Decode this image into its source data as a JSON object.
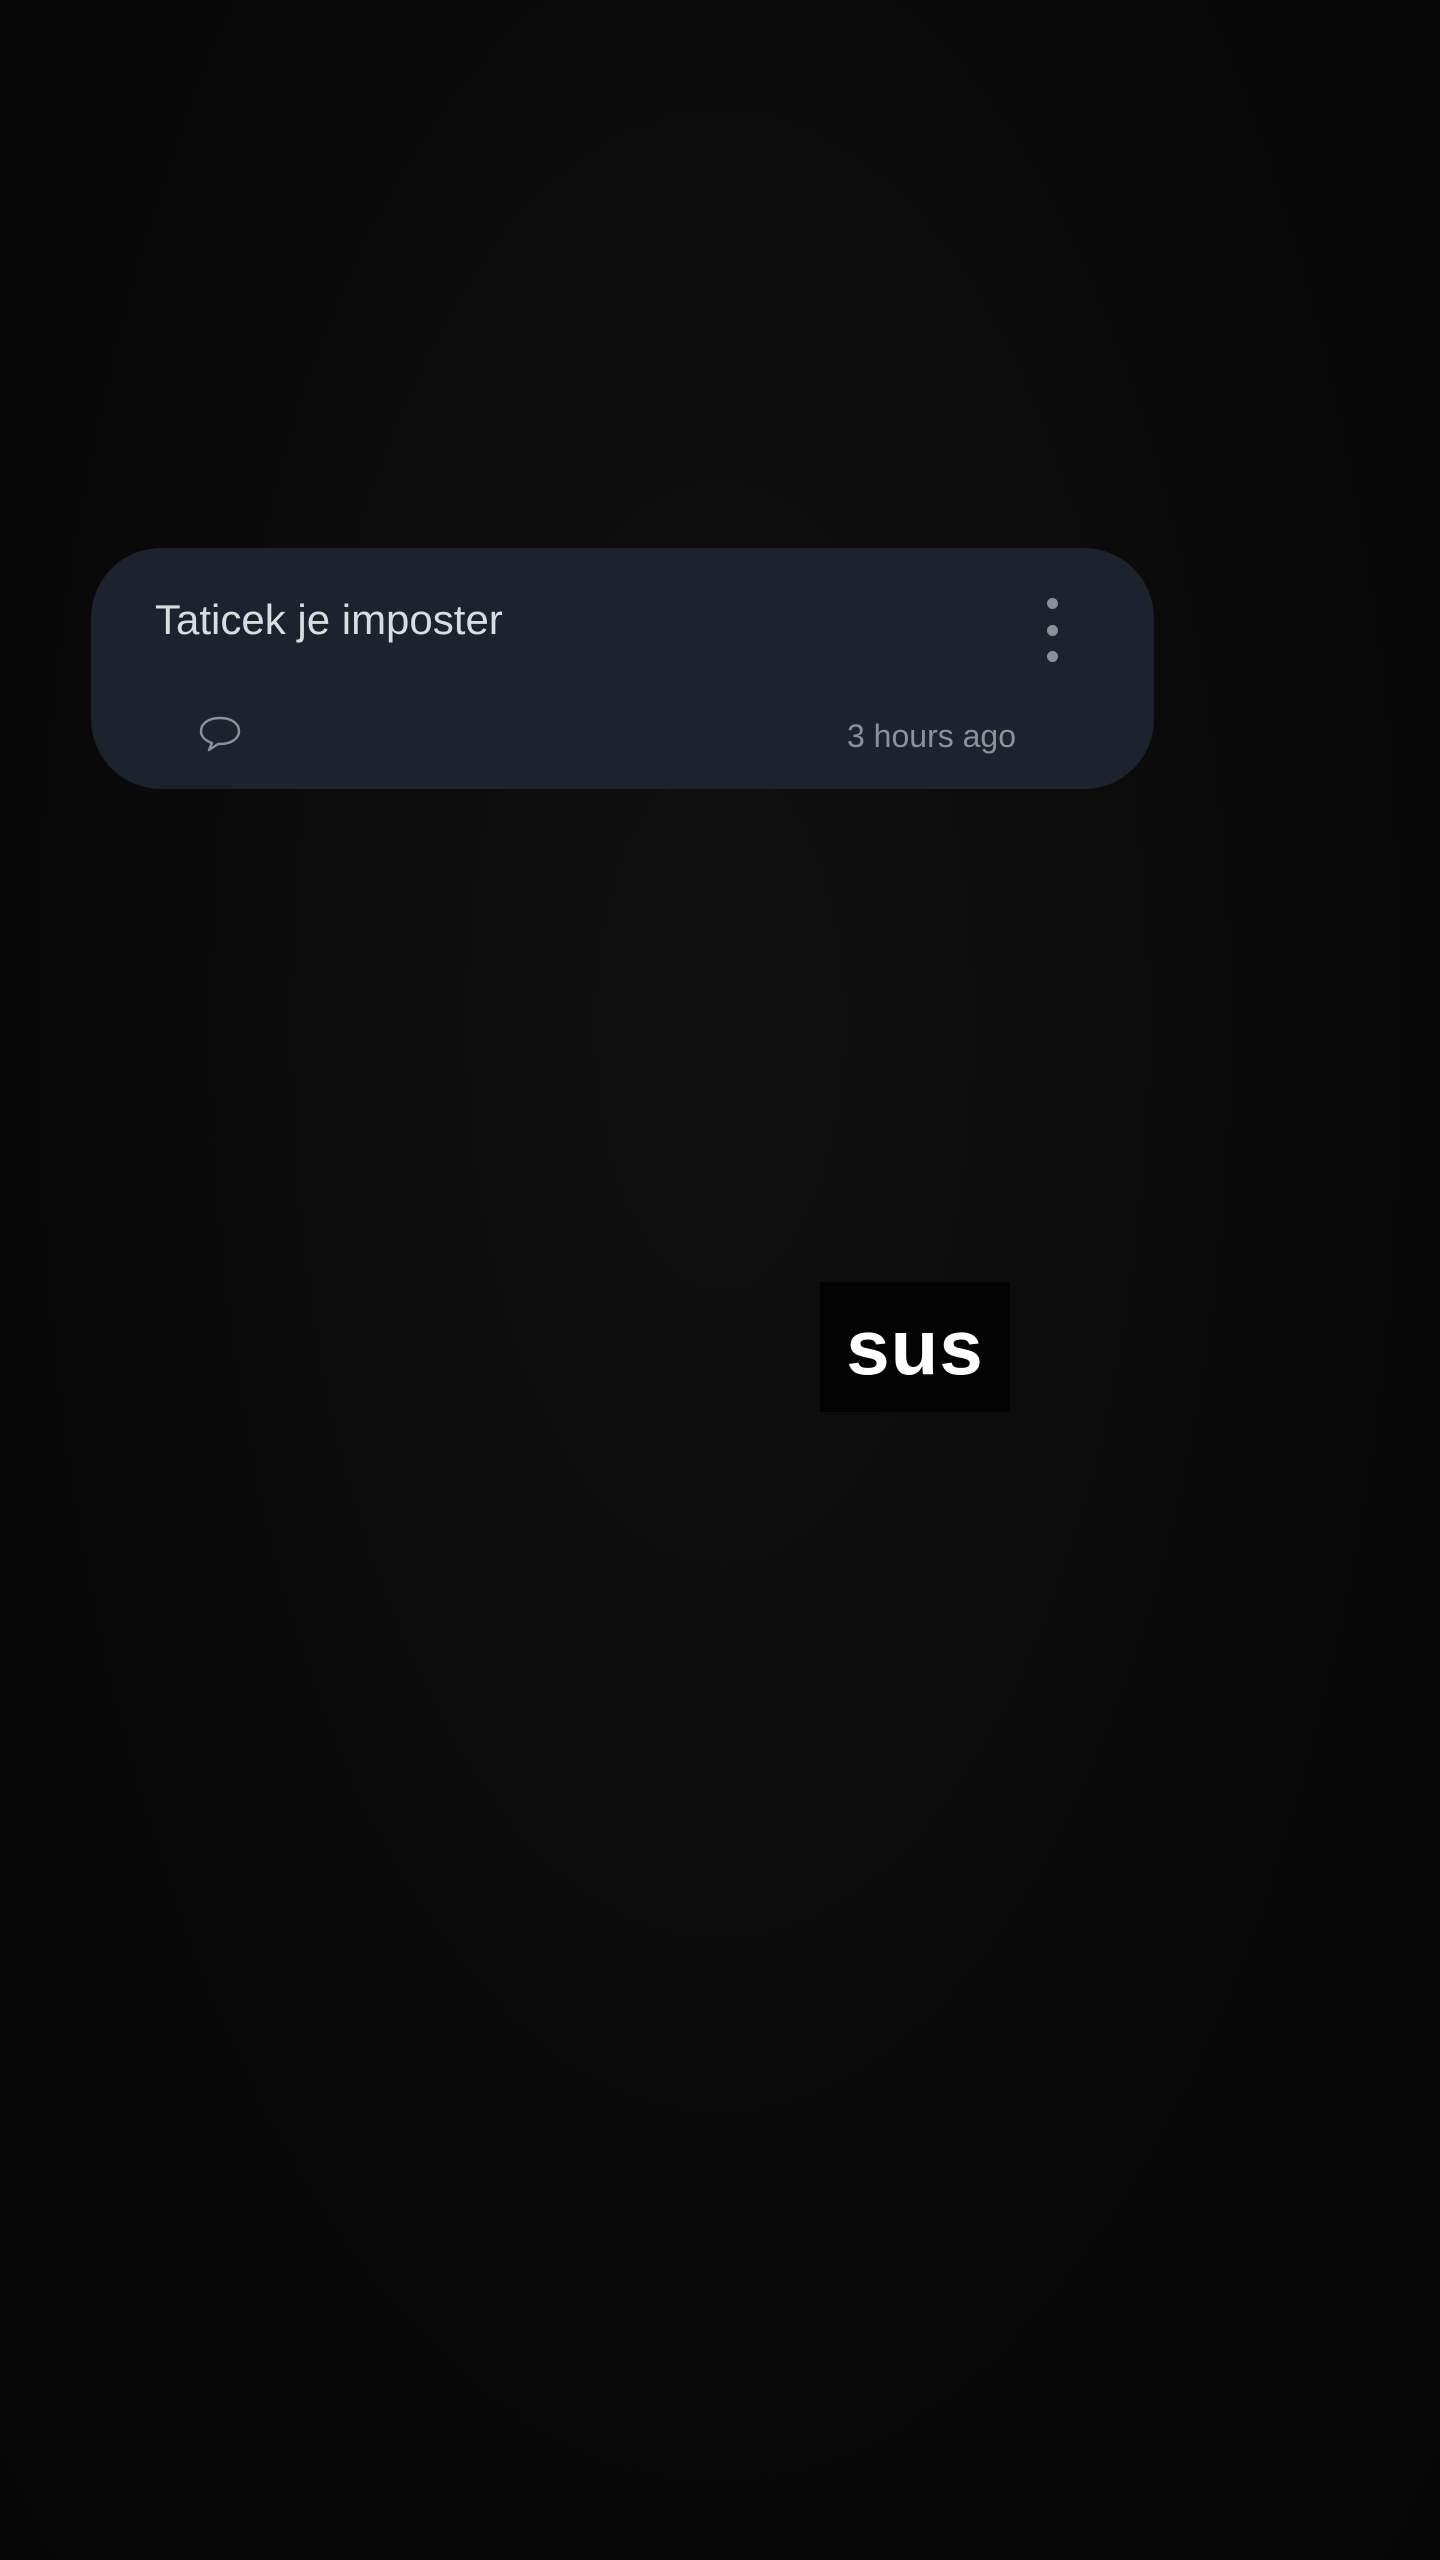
{
  "notification": {
    "title": "Taticek je imposter",
    "timestamp": "3 hours ago",
    "menu_icon": "more-vert-icon",
    "comment_icon": "comment-bubble-icon"
  },
  "overlay": {
    "text": "sus"
  },
  "colors": {
    "background": "#0a0a0a",
    "card": "#1d222c",
    "title_text": "#d9dce1",
    "secondary_text": "#8c9099"
  }
}
